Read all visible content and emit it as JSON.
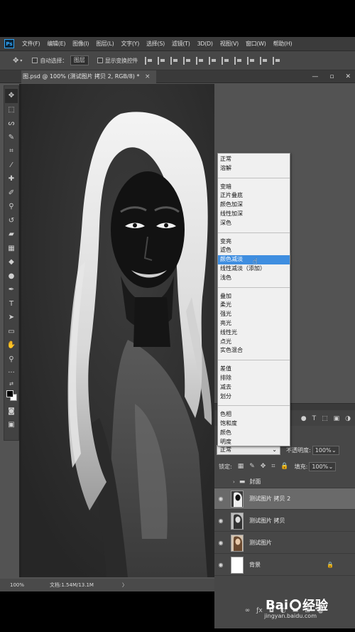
{
  "app": {
    "logo": "Ps",
    "menu": [
      "文件(F)",
      "编辑(E)",
      "图像(I)",
      "图层(L)",
      "文字(Y)",
      "选择(S)",
      "滤镜(T)",
      "3D(D)",
      "视图(V)",
      "窗口(W)",
      "帮助(H)"
    ]
  },
  "options": {
    "auto_select_label": "自动选择：",
    "auto_select_value": "图层",
    "show_transform_label": "显示变换控件"
  },
  "document": {
    "tab_title": "图.psd @ 100% (测试图片 拷贝 2, RGB/8) *",
    "tab_close": "×"
  },
  "status": {
    "zoom": "100%",
    "doc_info": "文档:1.54M/13.1M",
    "arrow": "〉"
  },
  "blend_modes": {
    "groups": [
      [
        "正常",
        "溶解"
      ],
      [
        "变暗",
        "正片叠底",
        "颜色加深",
        "线性加深",
        "深色"
      ],
      [
        "变亮",
        "滤色",
        "颜色减淡",
        "线性减淡（添加）",
        "浅色"
      ],
      [
        "叠加",
        "柔光",
        "强光",
        "亮光",
        "线性光",
        "点光",
        "实色混合"
      ],
      [
        "差值",
        "排除",
        "减去",
        "划分"
      ],
      [
        "色相",
        "饱和度",
        "颜色",
        "明度"
      ]
    ],
    "highlighted": "颜色减淡"
  },
  "layers_panel": {
    "blend_value": "正常",
    "opacity_label": "不透明度:",
    "opacity_value": "100%",
    "lock_label": "锁定:",
    "fill_label": "填充:",
    "fill_value": "100%",
    "layers": [
      {
        "name": "封面",
        "type": "group",
        "visible": false
      },
      {
        "name": "测试图片 拷贝 2",
        "type": "image",
        "visible": true,
        "active": true
      },
      {
        "name": "测试图片 拷贝",
        "type": "image",
        "visible": true,
        "active": false
      },
      {
        "name": "测试图片",
        "type": "image",
        "visible": true,
        "active": false
      },
      {
        "name": "背景",
        "type": "background",
        "visible": true,
        "locked": true
      }
    ]
  },
  "watermark": {
    "brand": "Bai",
    "brand_end": "经验",
    "url": "jingyan.baidu.com"
  },
  "colors": {
    "highlight": "#3f8ee0",
    "panel": "#474747"
  }
}
